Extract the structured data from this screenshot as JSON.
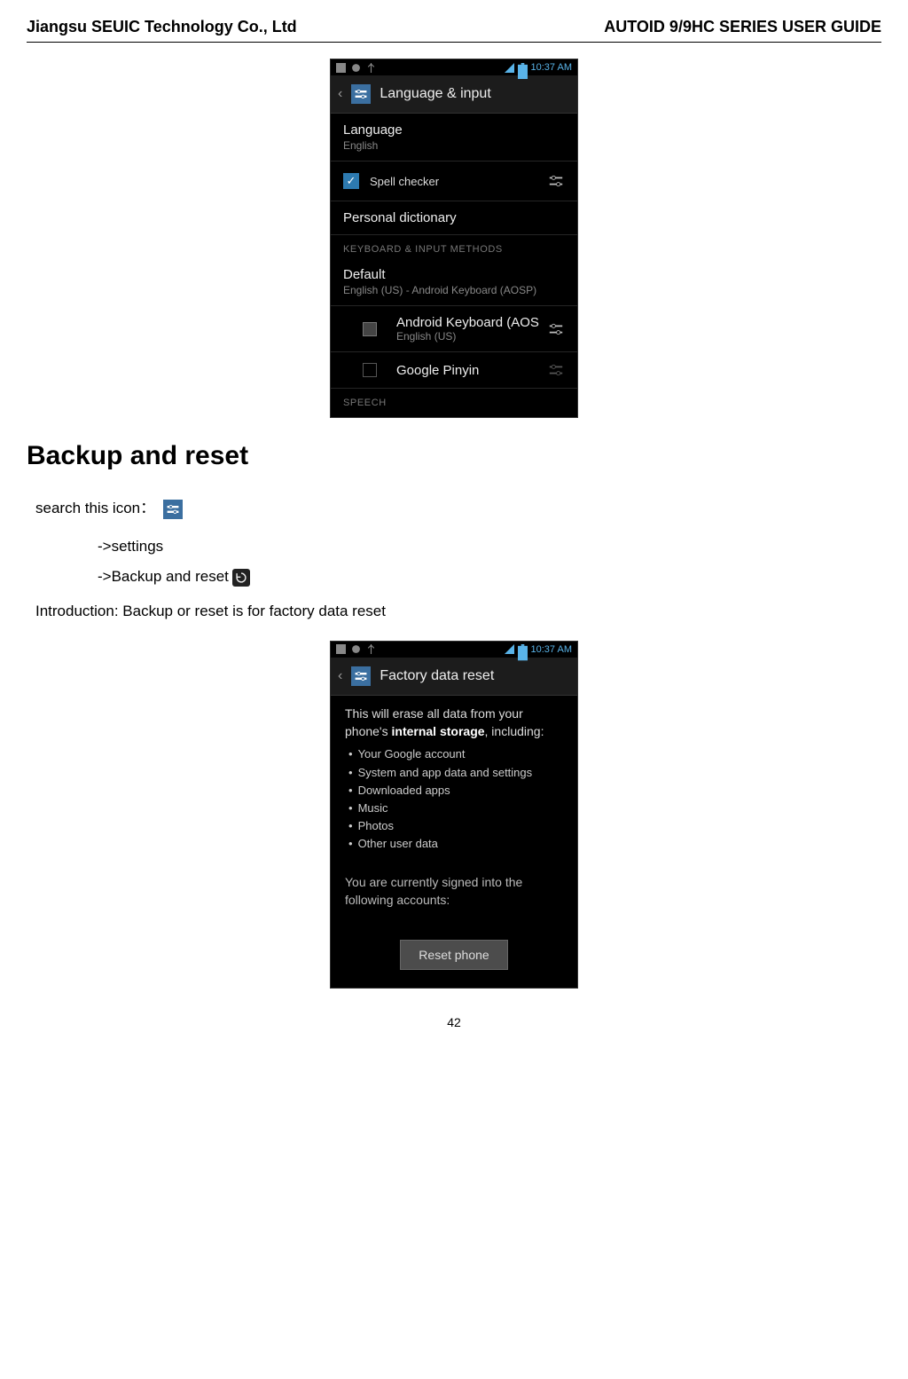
{
  "header": {
    "left": "Jiangsu SEUIC Technology Co., Ltd",
    "right": "AUTOID 9/9HC SERIES USER GUIDE"
  },
  "screenshot1": {
    "time": "10:37 AM",
    "title": "Language & input",
    "items": {
      "language": {
        "label": "Language",
        "value": "English"
      },
      "spell": "Spell checker",
      "dictionary": "Personal dictionary",
      "sectionKeyboard": "KEYBOARD & INPUT METHODS",
      "default": {
        "label": "Default",
        "value": "English (US) - Android Keyboard (AOSP)"
      },
      "aosp": {
        "label": "Android Keyboard (AOS",
        "sub": "English (US)"
      },
      "pinyin": "Google Pinyin",
      "speech": "SPEECH"
    }
  },
  "section": {
    "heading": "Backup and reset",
    "search_line": "search this icon：",
    "step1": "->settings",
    "step2": "->Backup and reset",
    "intro": "Introduction: Backup or reset is for factory data reset"
  },
  "screenshot2": {
    "time": "10:37 AM",
    "title": "Factory data reset",
    "erase_line1": "This will erase all data from your phone's ",
    "erase_storage": "internal storage",
    "erase_line2": ", including:",
    "bullets": [
      "Your Google account",
      "System and app data and settings",
      "Downloaded apps",
      "Music",
      "Photos",
      "Other user data"
    ],
    "signed": "You are currently signed into the following accounts:",
    "button": "Reset phone"
  },
  "page_number": "42"
}
